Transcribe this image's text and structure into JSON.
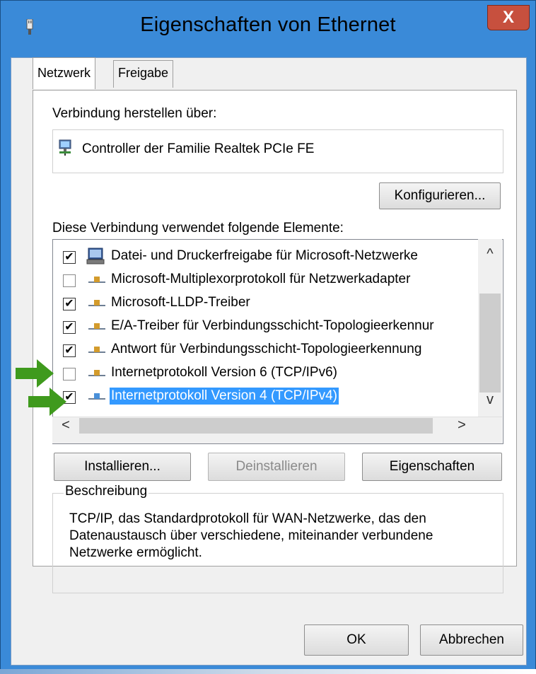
{
  "window": {
    "title": "Eigenschaften von Ethernet",
    "close_symbol": "X",
    "accent_color": "#3a8ad8",
    "close_color": "#c7503e"
  },
  "tabs": [
    {
      "label": "Netzwerk",
      "active": true
    },
    {
      "label": "Freigabe",
      "active": false
    }
  ],
  "connect_via": {
    "label": "Verbindung herstellen über:",
    "adapter_name": "Controller der Familie Realtek PCIe FE",
    "adapter_icon": "network-adapter-icon"
  },
  "configure_button": "Konfigurieren...",
  "elements_label": "Diese Verbindung verwendet folgende Elemente:",
  "items": [
    {
      "label": "Datei- und Druckerfreigabe für Microsoft-Netzwerke",
      "checked": true,
      "icon": "computer-icon",
      "selected": false
    },
    {
      "label": "Microsoft-Multiplexorprotokoll für Netzwerkadapter",
      "checked": false,
      "icon": "protocol-icon",
      "selected": false
    },
    {
      "label": "Microsoft-LLDP-Treiber",
      "checked": true,
      "icon": "protocol-icon",
      "selected": false
    },
    {
      "label": "E/A-Treiber für Verbindungsschicht-Topologieerkennur",
      "checked": true,
      "icon": "protocol-icon",
      "selected": false
    },
    {
      "label": "Antwort für Verbindungsschicht-Topologieerkennung",
      "checked": true,
      "icon": "protocol-icon",
      "selected": false
    },
    {
      "label": "Internetprotokoll Version 6 (TCP/IPv6)",
      "checked": false,
      "icon": "protocol-icon",
      "selected": false
    },
    {
      "label": "Internetprotokoll Version 4 (TCP/IPv4)",
      "checked": true,
      "icon": "protocol-icon",
      "selected": true
    }
  ],
  "scroll": {
    "up": "^",
    "down": "v",
    "left": "<",
    "right": ">"
  },
  "buttons": {
    "install": "Installieren...",
    "uninstall": "Deinstallieren",
    "properties": "Eigenschaften",
    "ok": "OK",
    "cancel": "Abbrechen"
  },
  "description": {
    "legend": "Beschreibung",
    "text": "TCP/IP, das Standardprotokoll für WAN-Netzwerke, das den Datenaustausch über verschiedene, miteinander verbundene Netzwerke ermöglicht."
  },
  "annotation_color": "#3f9a1d"
}
